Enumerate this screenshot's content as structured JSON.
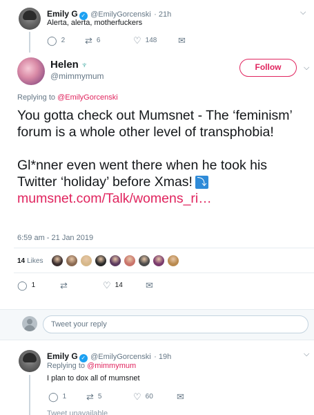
{
  "top_tweet": {
    "name": "Emily G",
    "handle": "@EmilyGorcenski",
    "time": "· 21h",
    "text": "Alerta, alerta, motherfuckers",
    "replies": "2",
    "retweets": "6",
    "likes": "148"
  },
  "main_tweet": {
    "name": "Helen",
    "handle": "@mimmymum",
    "follow_label": "Follow",
    "replying_prefix": "Replying to",
    "replying_to": "@EmilyGorcenski",
    "paragraph1": "You gotta check out Mumsnet - The ‘feminism’ forum is a whole other level of transphobia!",
    "paragraph2": "Gl*nner even went there when he took his Twitter ‘holiday’ before Xmas!",
    "link": "mumsnet.com/Talk/womens_ri…",
    "timestamp": "6:59 am - 21 Jan 2019",
    "likes_count": "14",
    "likes_label": "Likes",
    "replies": "1",
    "retweets": "",
    "likes": "14"
  },
  "reply_box": {
    "placeholder": "Tweet your reply"
  },
  "bottom_tweet": {
    "name": "Emily G",
    "handle": "@EmilyGorcenski",
    "time": "· 19h",
    "replying_prefix": "Replying to",
    "replying_to": "@mimmymum",
    "text": "I plan to dox all of mumsnet",
    "replies": "1",
    "retweets": "5",
    "likes": "60",
    "unavailable": "Tweet unavailable"
  },
  "colors": {
    "accent": "#e0245e",
    "verified": "#1da1f2",
    "muted": "#657786"
  },
  "liker_colors": [
    "#3b2f2f",
    "#8a6a52",
    "#d6b88a",
    "#2a2a2a",
    "#5b3a5e",
    "#c9746b",
    "#4a4a4a",
    "#7a3b6d",
    "#b98a4f"
  ]
}
